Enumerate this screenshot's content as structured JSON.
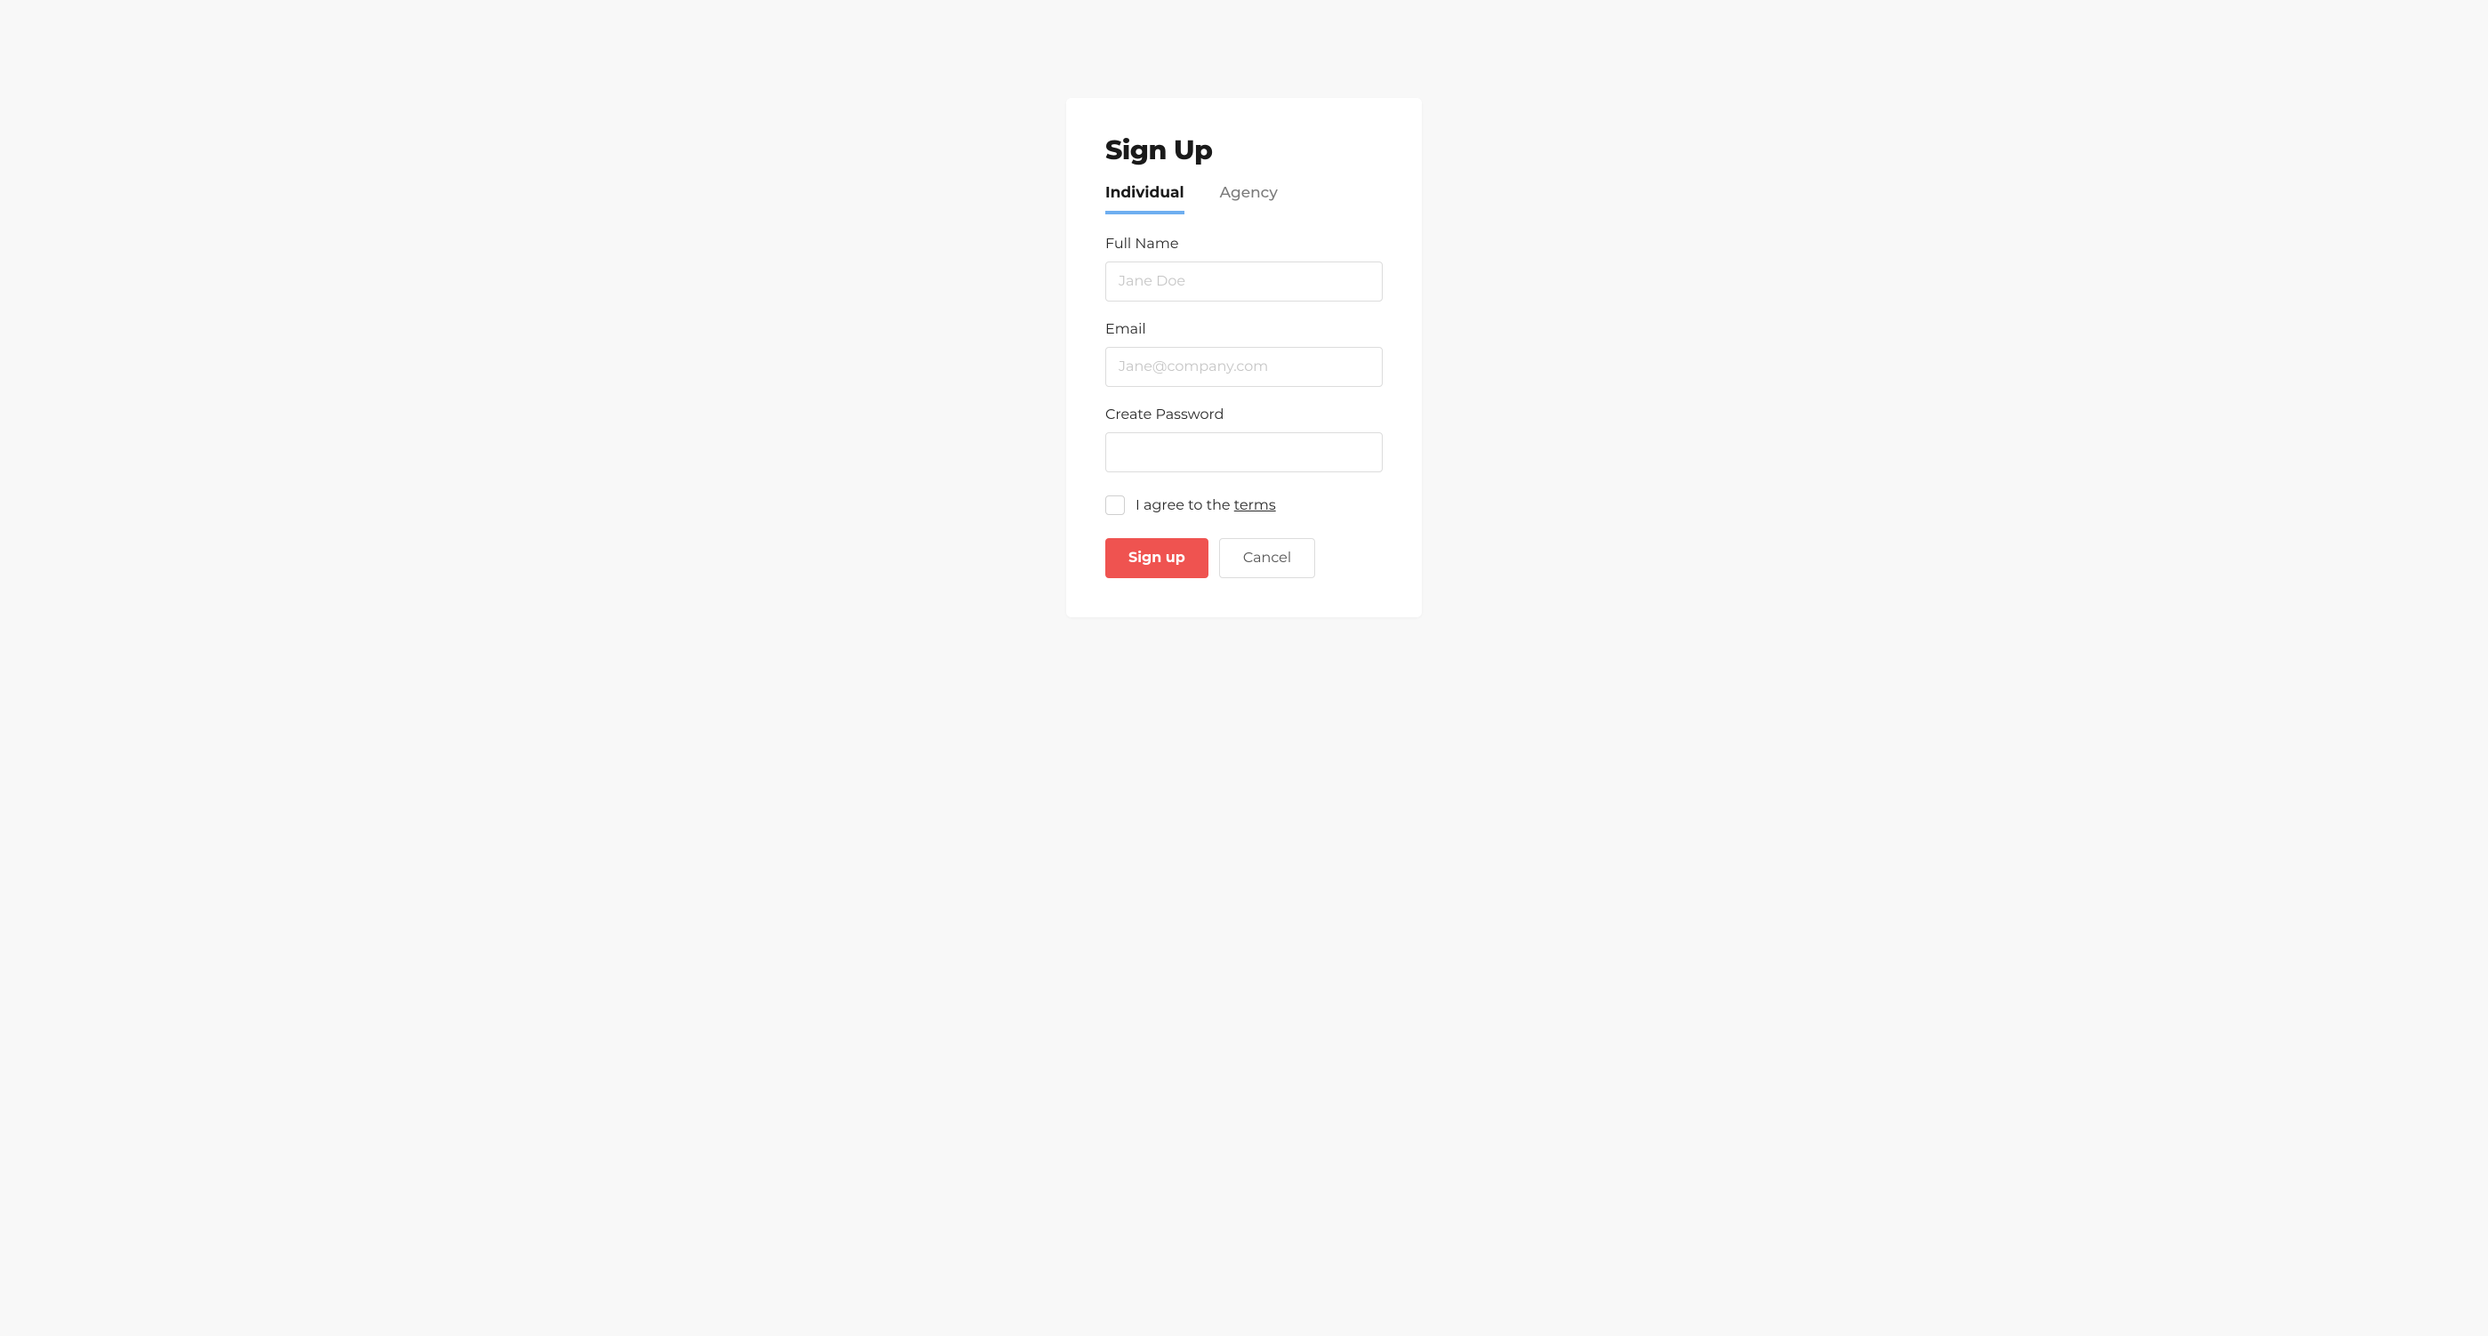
{
  "title": "Sign Up",
  "tabs": {
    "individual": "Individual",
    "agency": "Agency"
  },
  "fields": {
    "fullname": {
      "label": "Full Name",
      "placeholder": "Jane Doe",
      "value": ""
    },
    "email": {
      "label": "Email",
      "placeholder": "Jane@company.com",
      "value": ""
    },
    "password": {
      "label": "Create Password",
      "placeholder": "",
      "value": ""
    }
  },
  "terms": {
    "prefix": "I agree to the ",
    "link": "terms"
  },
  "buttons": {
    "signup": "Sign up",
    "cancel": "Cancel"
  }
}
